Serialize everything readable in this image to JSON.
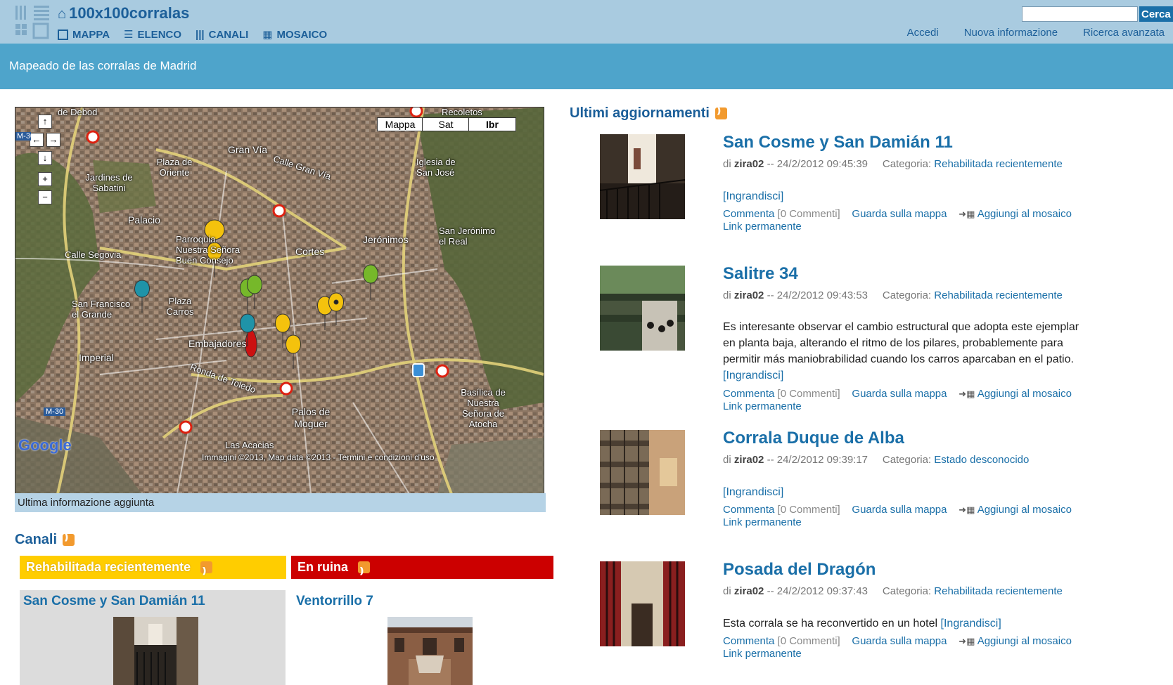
{
  "header": {
    "site_name": "100x100corralas",
    "nav": [
      {
        "label": "MAPPA",
        "icon": "square-icon"
      },
      {
        "label": "ELENCO",
        "icon": "list-icon"
      },
      {
        "label": "CANALI",
        "icon": "columns-icon"
      },
      {
        "label": "MOSAICO",
        "icon": "grid-icon"
      }
    ],
    "search": {
      "value": "",
      "button": "Cerca"
    },
    "user_nav": [
      "Accedi",
      "Nuova informazione",
      "Ricerca avanzata"
    ]
  },
  "page_title": "Mapeado de las corralas de Madrid",
  "map": {
    "types": [
      "Mappa",
      "Sat",
      "Ibr"
    ],
    "labels": [
      "de Debod",
      "Recoletos",
      "Gran Vía",
      "Calle Gran Vía",
      "Iglesia de San José",
      "Plaza de Oriente",
      "Jardines de Sabatini",
      "Palacio",
      "Parroquia Nuestra Señora Buen Consejo",
      "Cortes",
      "Jerónimos",
      "San Jerónimo el Real",
      "Calle Segovia",
      "San Francisco el Grande",
      "Plaza Carros",
      "Embajadores",
      "Imperial",
      "Ronda de Toledo",
      "Basílica de Nuestra Señora de Atocha",
      "Palos de Moguer",
      "Las Acacias",
      "M-30",
      "M-30"
    ],
    "attribution": "Immagini ©2013, Map data ©2013 - Termini e condizioni d'uso",
    "provider": "Google",
    "footer": "Ultima informazione aggiunta"
  },
  "channels": {
    "heading": "Canali",
    "items": [
      {
        "name": "Rehabilitada recientemente",
        "color": "#ffcd00",
        "first_item": "San Cosme y San Damián 11"
      },
      {
        "name": "En ruina",
        "color": "#cc0000",
        "first_item": "Ventorrillo 7"
      }
    ]
  },
  "updates": {
    "heading": "Ultimi aggiornamenti",
    "labels": {
      "by": "di",
      "category": "Categoria:",
      "expand": "[Ingrandisci]",
      "comment": "Commenta",
      "comments_count": "[0 Commenti]",
      "view_on_map": "Guarda sulla mappa",
      "add_to_mosaic": "Aggiungi al mosaico",
      "permalink": "Link permanente"
    },
    "posts": [
      {
        "title": "San Cosme y San Damián 11",
        "author": "zira02",
        "datetime": "-- 24/2/2012 09:45:39",
        "category": "Rehabilitada recientemente",
        "body": ""
      },
      {
        "title": "Salitre 34",
        "author": "zira02",
        "datetime": "-- 24/2/2012 09:43:53",
        "category": "Rehabilitada recientemente",
        "body": "Es interesante observar el cambio estructural que adopta este ejemplar en planta baja, alterando el ritmo de los pilares, probablemente para permitir más maniobrabilidad cuando los carros aparcaban en el patio."
      },
      {
        "title": "Corrala Duque de Alba",
        "author": "zira02",
        "datetime": "-- 24/2/2012 09:39:17",
        "category": "Estado desconocido",
        "body": ""
      },
      {
        "title": "Posada del Dragón",
        "author": "zira02",
        "datetime": "-- 24/2/2012 09:37:43",
        "category": "Rehabilitada recientemente",
        "body": "Esta corrala se ha reconvertido en un hotel"
      }
    ]
  }
}
